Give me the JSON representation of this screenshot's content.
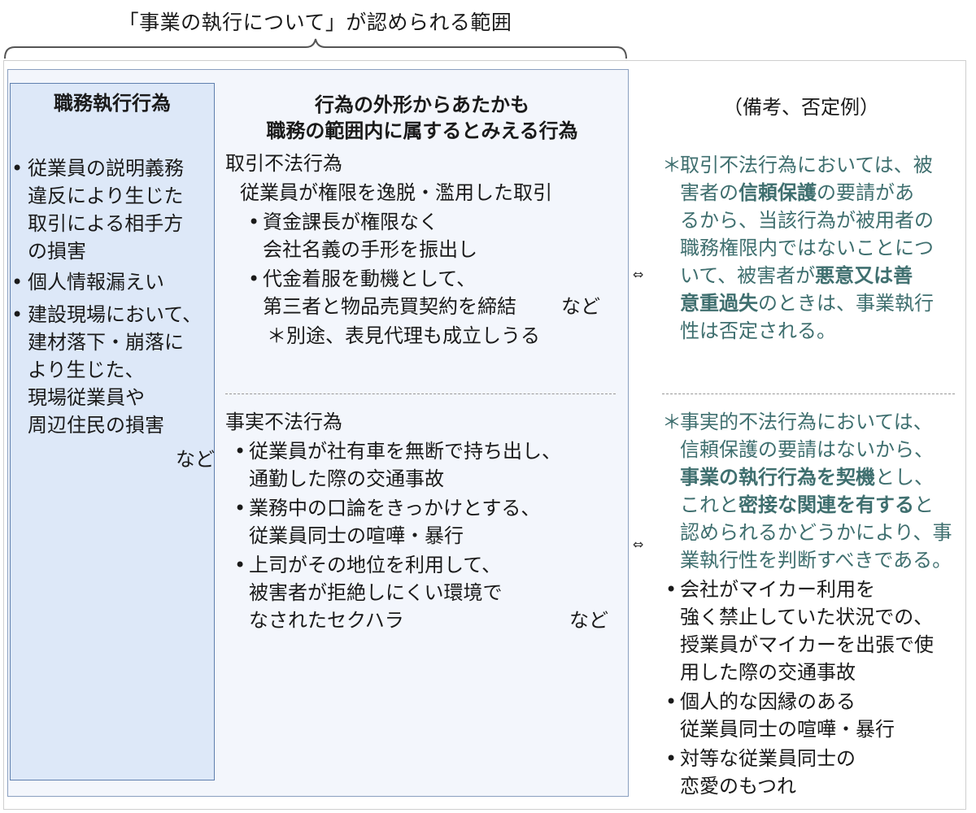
{
  "scope_caption": "「事業の執行について」が認められる範囲",
  "duty_column": {
    "heading": "職務執行行為",
    "items": [
      {
        "lines": [
          "従業員の説明義務",
          "違反により生じた",
          "取引による相手方",
          "の損害"
        ]
      },
      {
        "lines": [
          "個人情報漏えい"
        ]
      },
      {
        "lines": [
          "建設現場において、",
          "建材落下・崩落に",
          "より生じた、",
          "現場従業員や",
          "周辺住民の損害"
        ]
      }
    ],
    "etc": "など"
  },
  "appearance_column": {
    "heading_line1": "行為の外形からあたかも",
    "heading_line2": "職務の範囲内に属するとみえる行為",
    "transactional": {
      "title": "取引不法行為",
      "subtitle": "従業員が権限を逸脱・濫用した取引",
      "items": [
        {
          "lines": [
            "資金課長が権限なく",
            "会社名義の手形を振出し"
          ]
        },
        {
          "lines": [
            "代金着服を動機として、",
            "第三者と物品売買契約を締結"
          ]
        }
      ],
      "etc": "など",
      "note": "＊別途、表見代理も成立しうる"
    },
    "factual": {
      "title": "事実不法行為",
      "items": [
        {
          "lines": [
            "従業員が社有車を無断で持ち出し、",
            "通勤した際の交通事故"
          ]
        },
        {
          "lines": [
            "業務中の口論をきっかけとする、",
            "従業員同士の喧嘩・暴行"
          ]
        },
        {
          "lines": [
            "上司がその地位を利用して、",
            "被害者が拒絶しにくい環境で",
            "なされたセクハラ"
          ]
        }
      ],
      "etc": "など"
    }
  },
  "remarks_column": {
    "heading": "（備考、否定例）",
    "arrow_glyph": "⇔",
    "note_star": "＊",
    "transactional_note": {
      "l1": "取引不法行為においては、被",
      "l2a": "害者の",
      "l2b": "信頼保護",
      "l2c": "の要請があ",
      "l3": "るから、当該行為が被用者の",
      "l4": "職務権限内ではないことにつ",
      "l5a": "いて、被害者が",
      "l5b": "悪意又は善",
      "l6a": "意重過失",
      "l6b": "のときは、事業執行",
      "l7": "性は否定される。"
    },
    "factual_note": {
      "l1": "事実的不法行為においては、",
      "l2": "信頼保護の要請はないから、",
      "l3a": "事業の執行行為を契機",
      "l3b": "とし、",
      "l4a": "これと",
      "l4b": "密接な関連を有する",
      "l4c": "と",
      "l5": "認められるかどうかにより、事",
      "l6": "業執行性を判断すべきである。"
    },
    "negative_examples": [
      {
        "lines": [
          "会社がマイカー利用を",
          "強く禁止していた状況での、",
          "授業員がマイカーを出張で使",
          "用した際の交通事故"
        ]
      },
      {
        "lines": [
          "個人的な因縁のある",
          "従業員同士の喧嘩・暴行"
        ]
      },
      {
        "lines": [
          "対等な従業員同士の",
          "恋愛のもつれ"
        ]
      }
    ]
  },
  "colors": {
    "accent_teal": "#3f6f6f",
    "column_fill": "#dde8f8",
    "scope_fill": "#f3f6fc"
  }
}
